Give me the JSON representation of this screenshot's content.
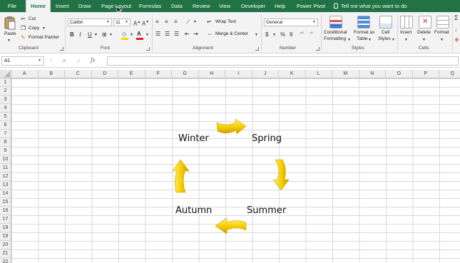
{
  "tabs": [
    {
      "label": "File",
      "active": false
    },
    {
      "label": "Home",
      "active": true
    },
    {
      "label": "Insert",
      "active": false
    },
    {
      "label": "Draw",
      "active": false
    },
    {
      "label": "Page Layout",
      "active": false
    },
    {
      "label": "Formulas",
      "active": false
    },
    {
      "label": "Data",
      "active": false
    },
    {
      "label": "Review",
      "active": false
    },
    {
      "label": "View",
      "active": false
    },
    {
      "label": "Developer",
      "active": false
    },
    {
      "label": "Help",
      "active": false
    },
    {
      "label": "Power Pivot",
      "active": false
    }
  ],
  "tell_me": "Tell me what you want to do",
  "ribbon": {
    "clipboard": {
      "paste": "Paste",
      "cut": "Cut",
      "copy": "Copy",
      "format_painter": "Format Painter",
      "label": "Clipboard"
    },
    "font": {
      "name": "Calibri",
      "size": "11",
      "label": "Font",
      "bold": "B",
      "italic": "I",
      "underline": "U"
    },
    "alignment": {
      "wrap_text": "Wrap Text",
      "merge_center": "Merge & Center",
      "label": "Alignment"
    },
    "number": {
      "format": "General",
      "currency": "$",
      "percent": "%",
      "comma": "9",
      "label": "Number"
    },
    "styles": {
      "conditional": "Conditional",
      "formatting": "Formatting",
      "format_as": "Format as",
      "table": "Table",
      "cell": "Cell",
      "styles": "Styles",
      "label": "Styles"
    },
    "cells": {
      "insert": "Insert",
      "delete": "Delete",
      "format": "Format",
      "label": "Cells"
    }
  },
  "formula_bar": {
    "name_box": "A1",
    "fx": "fx",
    "cancel": "✕",
    "enter": "✓",
    "value": ""
  },
  "columns": [
    "A",
    "B",
    "C",
    "D",
    "E",
    "F",
    "G",
    "H",
    "I",
    "J",
    "K",
    "L",
    "M",
    "N",
    "O",
    "P",
    "Q"
  ],
  "rows": [
    "1",
    "2",
    "3",
    "4",
    "5",
    "6",
    "7",
    "8",
    "9",
    "10",
    "11",
    "12",
    "13",
    "14",
    "15",
    "16",
    "17",
    "18",
    "19",
    "20",
    "21",
    "22"
  ],
  "cycle": {
    "labels": {
      "winter": "Winter",
      "spring": "Spring",
      "summer": "Summer",
      "autumn": "Autumn"
    },
    "arrow_color": "#f2c400",
    "arrow_highlight": "#fff06a"
  }
}
